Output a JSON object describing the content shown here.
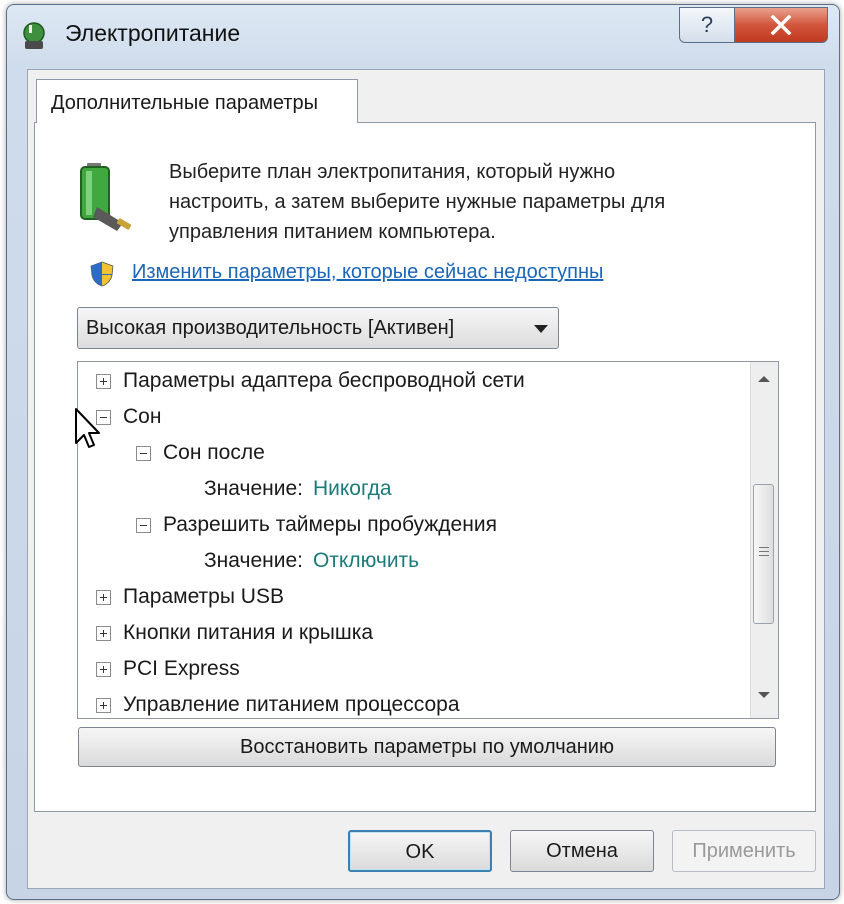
{
  "window": {
    "title": "Электропитание",
    "help_label": "?"
  },
  "tab": {
    "label": "Дополнительные параметры"
  },
  "description": "Выберите план электропитания, который нужно настроить, а затем выберите нужные параметры для управления питанием компьютера.",
  "description_lines": [
    "Выберите план электропитания, который нужно",
    "настроить, а затем выберите нужные параметры для",
    "управления питанием компьютера."
  ],
  "link": "Изменить параметры, которые сейчас недоступны",
  "plan_select": {
    "value": "Высокая производительность [Активен]"
  },
  "tree": [
    {
      "label": "Параметры адаптера беспроводной сети",
      "level": 0,
      "state": "collapsed"
    },
    {
      "label": "Сон",
      "level": 0,
      "state": "expanded"
    },
    {
      "label": "Сон после",
      "level": 1,
      "state": "expanded"
    },
    {
      "label": "Значение:",
      "value": "Никогда",
      "level": 2
    },
    {
      "label": "Разрешить таймеры пробуждения",
      "level": 1,
      "state": "expanded"
    },
    {
      "label": "Значение:",
      "value": "Отключить",
      "level": 2
    },
    {
      "label": "Параметры USB",
      "level": 0,
      "state": "collapsed"
    },
    {
      "label": "Кнопки питания и крышка",
      "level": 0,
      "state": "collapsed"
    },
    {
      "label": "PCI Express",
      "level": 0,
      "state": "collapsed"
    },
    {
      "label": "Управление питанием процессора",
      "level": 0,
      "state": "collapsed"
    }
  ],
  "buttons": {
    "restore": "Восстановить параметры по умолчанию",
    "ok": "OK",
    "cancel": "Отмена",
    "apply": "Применить"
  },
  "colors": {
    "link": "#1a66b8",
    "value_text": "#1d7a7a",
    "title_bg": "#cfdceb",
    "close_button": "#c8432a"
  }
}
